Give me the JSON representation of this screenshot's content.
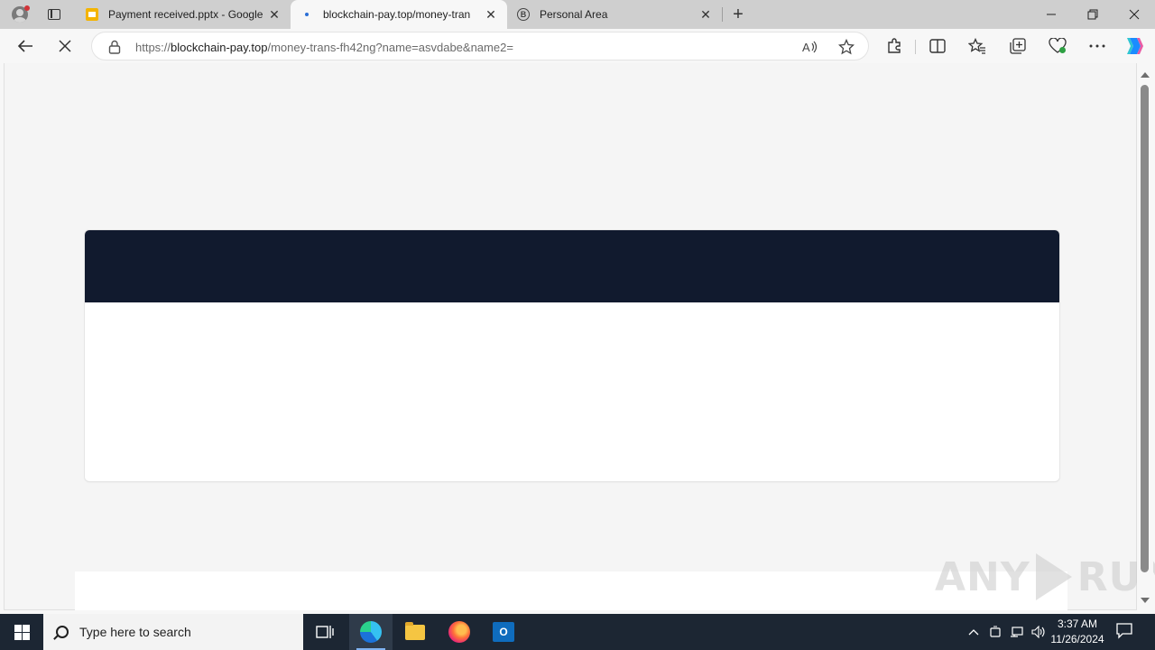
{
  "browser": {
    "tabs": [
      {
        "title": "Payment received.pptx - Google",
        "favicon": "slides-icon"
      },
      {
        "title": "blockchain-pay.top/money-tran",
        "favicon": "loading-dot-icon",
        "active": true
      },
      {
        "title": "Personal Area",
        "favicon": "b-circle-icon"
      }
    ],
    "close_glyph": "✕",
    "new_tab_glyph": "+",
    "address": {
      "scheme": "https://",
      "domain": "blockchain-pay.top",
      "path": "/money-trans-fh42ng?name=asvdabe&name2="
    }
  },
  "page": {
    "header_color": "#111a2e",
    "background_color": "#f5f5f5",
    "card_color": "#ffffff"
  },
  "watermark": {
    "left": "ANY",
    "right": "RUN"
  },
  "taskbar": {
    "search_placeholder": "Type here to search",
    "apps": [
      "task-view",
      "edge",
      "file-explorer",
      "firefox",
      "outlook"
    ],
    "outlook_letter": "O",
    "time": "3:37 AM",
    "date": "11/26/2024"
  }
}
